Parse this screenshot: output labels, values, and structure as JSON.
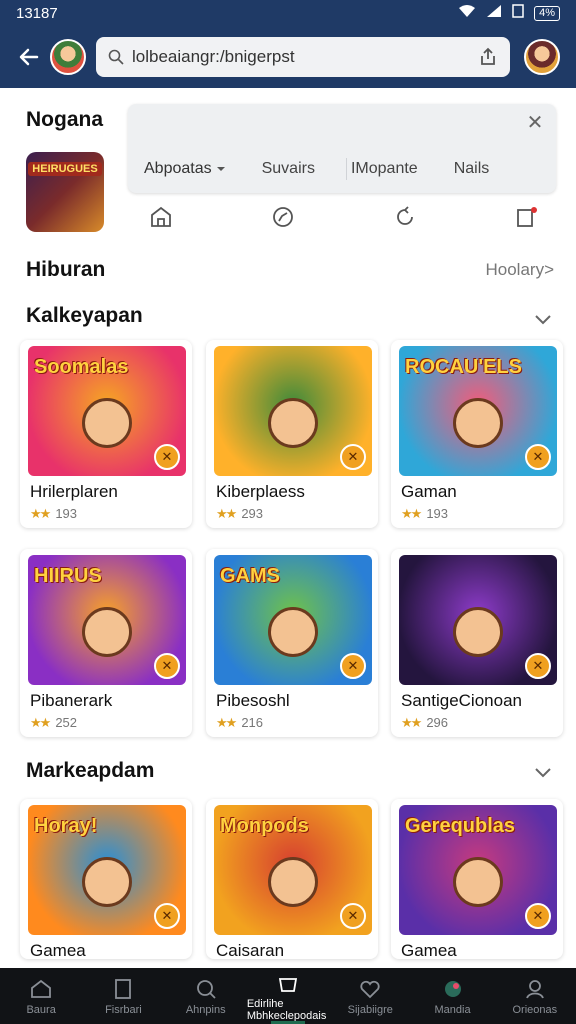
{
  "status_bar": {
    "time": "13187",
    "battery": "4%"
  },
  "header": {
    "url": "lolbeaiangr:/bnigerpst"
  },
  "content": {
    "featured_title": "Nogana",
    "featured_icon_text": "HEIRUGUES",
    "popup": {
      "tabs": [
        "Abpoatas",
        "Suvairs",
        "IMopante",
        "Nails"
      ]
    },
    "section1": {
      "title": "Hiburan",
      "see_more": "Hoolary>"
    },
    "section2": {
      "title": "Kalkeyapan"
    },
    "section3": {
      "title": "Markeapdam"
    },
    "cards_row1": [
      {
        "title": "Hrilerplaren",
        "rating": "193",
        "thumb_word": "Soomalas",
        "colors": [
          "#e8326a",
          "#f6a623"
        ]
      },
      {
        "title": "Kiberplaess",
        "rating": "293",
        "thumb_word": "",
        "colors": [
          "#ffb12a",
          "#3f8a3a"
        ]
      },
      {
        "title": "Gaman",
        "rating": "193",
        "thumb_word": "ROCAU'ELS",
        "colors": [
          "#2fa7d8",
          "#f25c7a"
        ]
      }
    ],
    "cards_row2": [
      {
        "title": "Pibanerark",
        "rating": "252",
        "thumb_word": "HIIRUS",
        "colors": [
          "#8a2fc4",
          "#f7a129"
        ]
      },
      {
        "title": "Pibesoshl",
        "rating": "216",
        "thumb_word": "GAMS",
        "colors": [
          "#2a7fd6",
          "#6fc24a"
        ]
      },
      {
        "title": "SantigeCionoan",
        "rating": "296",
        "thumb_word": "",
        "colors": [
          "#24153e",
          "#8d3bc9"
        ]
      }
    ],
    "cards_row3": [
      {
        "title": "Gamea",
        "rating": "",
        "thumb_word": "Horay!",
        "colors": [
          "#ff8a1e",
          "#2b8fd4"
        ]
      },
      {
        "title": "Caisaran",
        "rating": "",
        "thumb_word": "Monpods",
        "colors": [
          "#f2a21f",
          "#d6402f"
        ]
      },
      {
        "title": "Gamea",
        "rating": "",
        "thumb_word": "Gerequblas",
        "colors": [
          "#5a2fa8",
          "#c63a7f"
        ]
      }
    ]
  },
  "bottom_nav": [
    {
      "label": "Baura",
      "icon": "home-icon"
    },
    {
      "label": "Fisrbari",
      "icon": "book-icon"
    },
    {
      "label": "Ahnpins",
      "icon": "search-icon"
    },
    {
      "label": "Edirlihe Mbhkeclepodais",
      "icon": "store-icon",
      "active": true
    },
    {
      "label": "Sijabiigre",
      "icon": "heart-icon"
    },
    {
      "label": "Mandia",
      "icon": "media-icon"
    },
    {
      "label": "Orieonas",
      "icon": "profile-icon"
    }
  ]
}
